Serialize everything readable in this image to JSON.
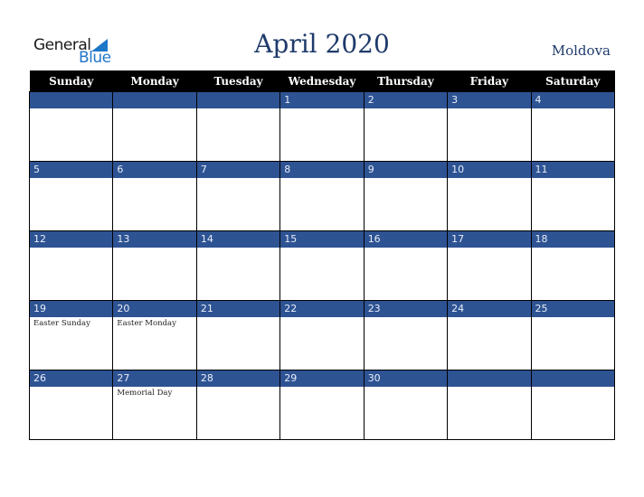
{
  "logo": {
    "general": "General",
    "blue": "Blue"
  },
  "header": {
    "title": "April 2020",
    "country": "Moldova"
  },
  "calendar": {
    "weekdays": [
      "Sunday",
      "Monday",
      "Tuesday",
      "Wednesday",
      "Thursday",
      "Friday",
      "Saturday"
    ],
    "weeks": [
      [
        {
          "day": "",
          "holiday": ""
        },
        {
          "day": "",
          "holiday": ""
        },
        {
          "day": "",
          "holiday": ""
        },
        {
          "day": "1",
          "holiday": ""
        },
        {
          "day": "2",
          "holiday": ""
        },
        {
          "day": "3",
          "holiday": ""
        },
        {
          "day": "4",
          "holiday": ""
        }
      ],
      [
        {
          "day": "5",
          "holiday": ""
        },
        {
          "day": "6",
          "holiday": ""
        },
        {
          "day": "7",
          "holiday": ""
        },
        {
          "day": "8",
          "holiday": ""
        },
        {
          "day": "9",
          "holiday": ""
        },
        {
          "day": "10",
          "holiday": ""
        },
        {
          "day": "11",
          "holiday": ""
        }
      ],
      [
        {
          "day": "12",
          "holiday": ""
        },
        {
          "day": "13",
          "holiday": ""
        },
        {
          "day": "14",
          "holiday": ""
        },
        {
          "day": "15",
          "holiday": ""
        },
        {
          "day": "16",
          "holiday": ""
        },
        {
          "day": "17",
          "holiday": ""
        },
        {
          "day": "18",
          "holiday": ""
        }
      ],
      [
        {
          "day": "19",
          "holiday": "Easter Sunday"
        },
        {
          "day": "20",
          "holiday": "Easter Monday"
        },
        {
          "day": "21",
          "holiday": ""
        },
        {
          "day": "22",
          "holiday": ""
        },
        {
          "day": "23",
          "holiday": ""
        },
        {
          "day": "24",
          "holiday": ""
        },
        {
          "day": "25",
          "holiday": ""
        }
      ],
      [
        {
          "day": "26",
          "holiday": ""
        },
        {
          "day": "27",
          "holiday": "Memorial Day"
        },
        {
          "day": "28",
          "holiday": ""
        },
        {
          "day": "29",
          "holiday": ""
        },
        {
          "day": "30",
          "holiday": ""
        },
        {
          "day": "",
          "holiday": ""
        },
        {
          "day": "",
          "holiday": ""
        }
      ]
    ]
  },
  "colors": {
    "header_bg": "#000000",
    "date_bar": "#2e5393",
    "title": "#1f3b6b",
    "logo_blue": "#1f77c8"
  }
}
